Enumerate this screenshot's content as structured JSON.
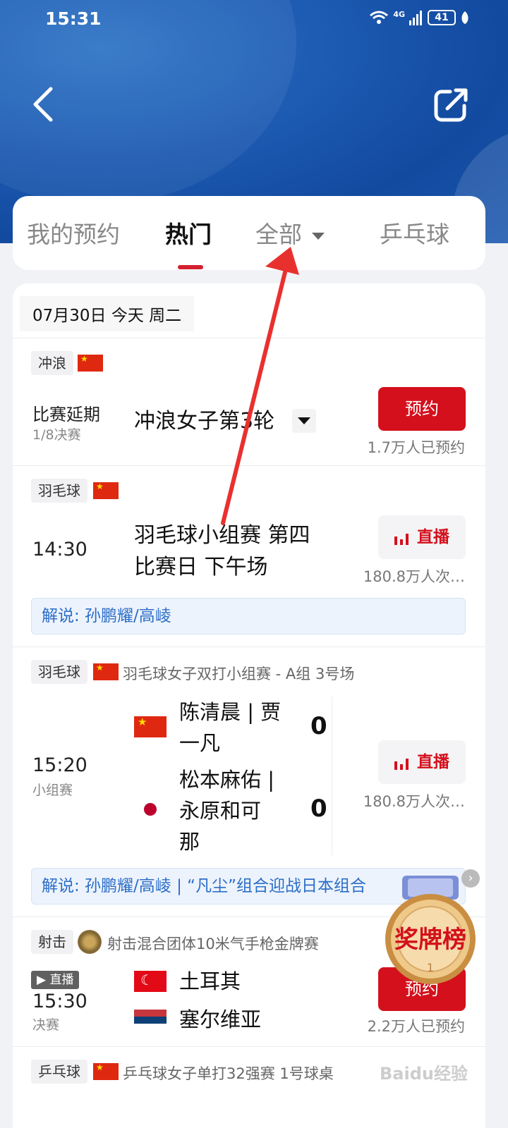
{
  "status_bar": {
    "time": "15:31",
    "network": "4G",
    "battery": "41"
  },
  "tabs": [
    {
      "label": "我的预约",
      "active": false
    },
    {
      "label": "热门",
      "active": true
    },
    {
      "label": "全部",
      "active": false
    },
    {
      "label": "乒乓球",
      "active": false
    }
  ],
  "date_header": "07月30日 今天 周二",
  "events": [
    {
      "sport": "冲浪",
      "status": "比赛延期",
      "round": "1/8决赛",
      "title": "冲浪女子第3轮",
      "action": "预约",
      "count": "1.7万人已预约"
    },
    {
      "sport": "羽毛球",
      "time": "14:30",
      "title_line1": "羽毛球小组赛 第四",
      "title_line2": "比赛日 下午场",
      "action": "直播",
      "count": "180.8万人次…",
      "commentary": "解说: 孙鹏耀/高崚"
    },
    {
      "sport": "羽毛球",
      "event_name": "羽毛球女子双打小组赛 - A组 3号场",
      "time": "15:20",
      "stage": "小组赛",
      "team1_line1": "陈清晨 | 贾",
      "team1_line2": "一凡",
      "team1_score": "0",
      "team2_line1": "松本麻佑 |",
      "team2_line2": "永原和可",
      "team2_line3": "那",
      "team2_score": "0",
      "action": "直播",
      "count": "180.8万人次…",
      "commentary": "解说: 孙鹏耀/高崚 | “凡尘”组合迎战日本组合"
    },
    {
      "sport": "射击",
      "event_name": "射击混合团体10米气手枪金牌赛",
      "live_badge": "▶ 直播",
      "time": "15:30",
      "stage": "决赛",
      "team1": "土耳其",
      "team2": "塞尔维亚",
      "action": "预约",
      "count": "2.2万人已预约"
    },
    {
      "sport": "乒乓球",
      "event_name": "乒乓球女子单打32强赛 1号球桌"
    }
  ],
  "medal_widget": {
    "label": "奖牌榜",
    "rank": "1"
  },
  "watermark": "Baidu经验"
}
